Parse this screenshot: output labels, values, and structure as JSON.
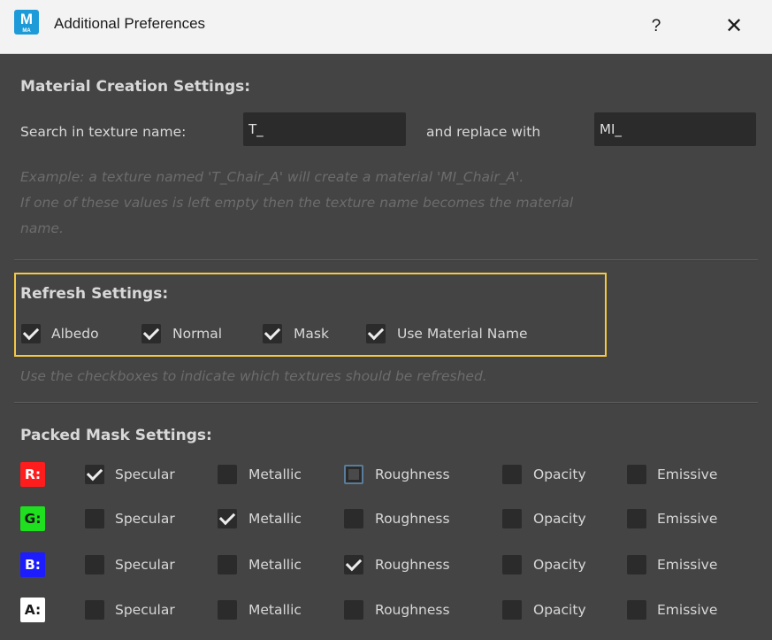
{
  "window": {
    "title": "Additional Preferences",
    "icon_letter": "M",
    "icon_sub": "MA",
    "help_label": "?",
    "close_label": "✕"
  },
  "material": {
    "heading": "Material Creation Settings:",
    "search_label": "Search in texture name:",
    "search_value": "T_",
    "replace_label": "and replace with",
    "replace_value": "MI_",
    "hint_line1": "Example: a texture named 'T_Chair_A' will create a material 'MI_Chair_A'.",
    "hint_line2": "If one of these values is left empty then the texture name becomes the material",
    "hint_line3": "name."
  },
  "refresh": {
    "heading": "Refresh Settings:",
    "items": [
      {
        "label": "Albedo",
        "checked": true
      },
      {
        "label": "Normal",
        "checked": true
      },
      {
        "label": "Mask",
        "checked": true
      },
      {
        "label": "Use Material Name",
        "checked": true
      }
    ],
    "hint": "Use the checkboxes to indicate which textures should be refreshed."
  },
  "packed": {
    "heading": "Packed Mask Settings:",
    "columns": [
      "Specular",
      "Metallic",
      "Roughness",
      "Opacity",
      "Emissive"
    ],
    "rows": [
      {
        "channel": "R:",
        "color": "#ff1c1c",
        "text_color": "#ffffff",
        "states": [
          "checked",
          "unchecked",
          "partial",
          "unchecked",
          "unchecked"
        ]
      },
      {
        "channel": "G:",
        "color": "#1fe01f",
        "text_color": "#1a1a1a",
        "states": [
          "unchecked",
          "checked",
          "unchecked",
          "unchecked",
          "unchecked"
        ]
      },
      {
        "channel": "B:",
        "color": "#1c1cff",
        "text_color": "#ffffff",
        "states": [
          "unchecked",
          "unchecked",
          "checked",
          "unchecked",
          "unchecked"
        ]
      },
      {
        "channel": "A:",
        "color": "#ffffff",
        "text_color": "#1a1a1a",
        "states": [
          "unchecked",
          "unchecked",
          "unchecked",
          "unchecked",
          "unchecked"
        ]
      }
    ]
  }
}
